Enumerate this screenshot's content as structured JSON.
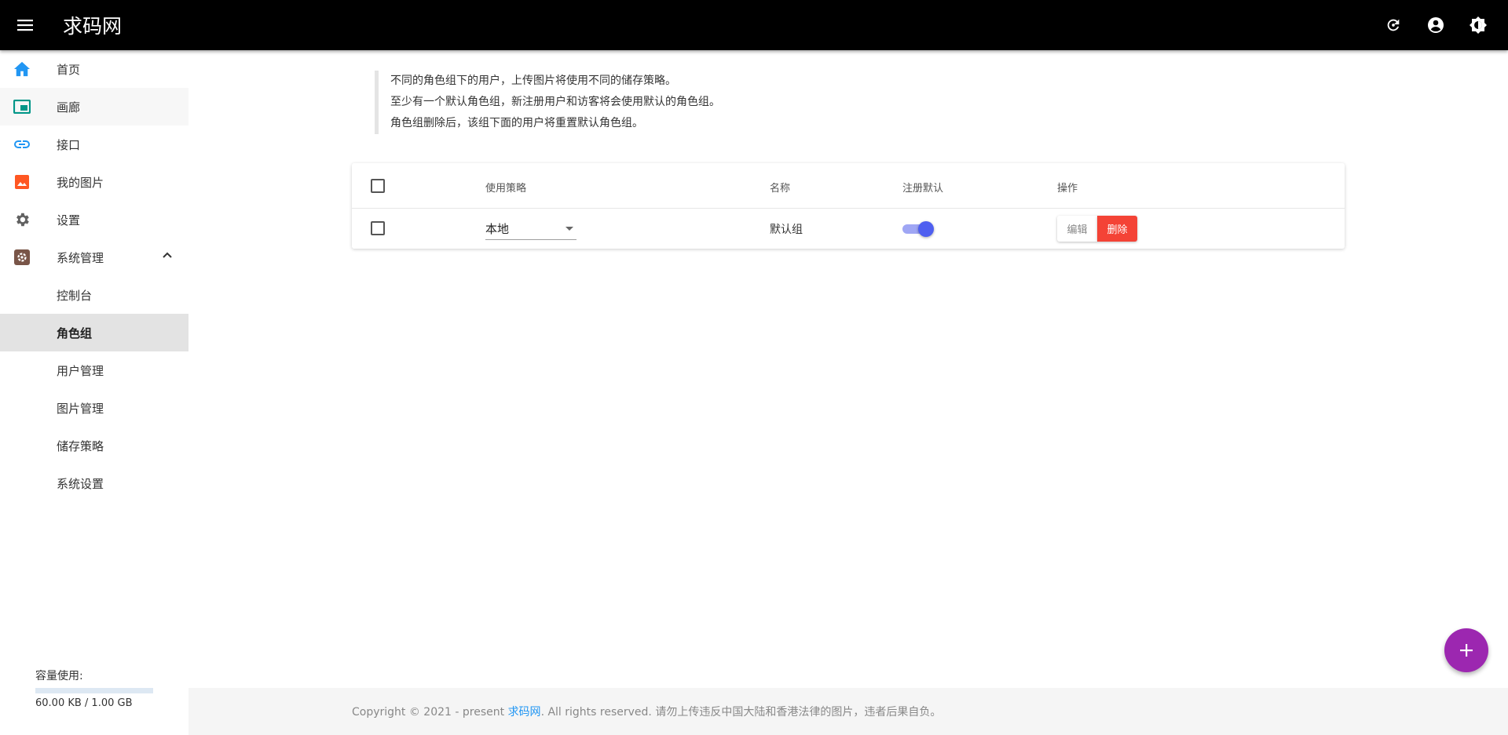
{
  "app": {
    "title": "求码网"
  },
  "header": {
    "icons": [
      "menu-icon",
      "refresh-icon",
      "account-icon",
      "theme-icon"
    ]
  },
  "sidebar": {
    "items": [
      {
        "label": "首页",
        "icon": "home-icon",
        "color": "#2196f3"
      },
      {
        "label": "画廊",
        "icon": "gallery-icon",
        "color": "#009688"
      },
      {
        "label": "接口",
        "icon": "link-icon",
        "color": "#2196f3"
      },
      {
        "label": "我的图片",
        "icon": "image-icon",
        "color": "#ff5722"
      },
      {
        "label": "设置",
        "icon": "settings-icon",
        "color": "#616161"
      },
      {
        "label": "系统管理",
        "icon": "admin-icon",
        "color": "#795548"
      }
    ],
    "sub_items": [
      "控制台",
      "角色组",
      "用户管理",
      "图片管理",
      "储存策略",
      "系统设置"
    ],
    "active_sub": "角色组",
    "quota": {
      "label": "容量使用:",
      "text": "60.00 KB / 1.00 GB",
      "fraction": 6e-05
    }
  },
  "notice": {
    "lines": [
      "不同的角色组下的用户，上传图片将使用不同的储存策略。",
      "至少有一个默认角色组，新注册用户和访客将会使用默认的角色组。",
      "角色组删除后，该组下面的用户将重置默认角色组。"
    ]
  },
  "table": {
    "headers": {
      "strategy": "使用策略",
      "name": "名称",
      "default": "注册默认",
      "actions": "操作"
    },
    "rows": [
      {
        "strategy": "本地",
        "name": "默认组",
        "default_on": true,
        "edit": "编辑",
        "delete": "删除"
      }
    ]
  },
  "footer": {
    "prefix": "Copyright © 2021 - present ",
    "link": "求码网",
    "suffix": ". All rights reserved. 请勿上传违反中国大陆和香港法律的图片，违者后果自负。"
  },
  "colors": {
    "accent": "#2196f3",
    "danger": "#f44336",
    "fab": "#9c27b0",
    "switch": "#4f5ff0"
  }
}
